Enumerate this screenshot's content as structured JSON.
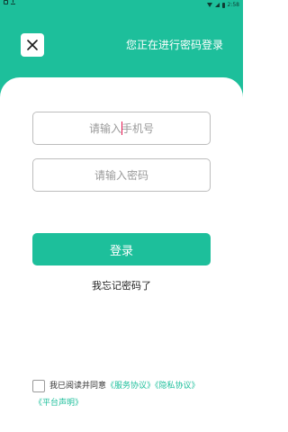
{
  "status_bar": {
    "time": "2:58",
    "icons": [
      "sim-icon",
      "download-icon",
      "wifi-icon",
      "signal-icon",
      "battery-icon"
    ]
  },
  "header": {
    "close_icon": "close-icon",
    "title": "您正在进行密码登录"
  },
  "form": {
    "phone_placeholder": "请输入手机号",
    "phone_value": "",
    "password_placeholder": "请输入密码",
    "password_value": "",
    "login_label": "登录",
    "forgot_label": "我忘记密码了"
  },
  "agreement": {
    "checked": false,
    "prefix": "我已阅读并同意",
    "service_link": "《服务协议》",
    "privacy_link": "《隐私协议》",
    "platform_link": "《平台声明》"
  },
  "colors": {
    "brand": "#1dbf9b",
    "caret": "#e5144f"
  }
}
